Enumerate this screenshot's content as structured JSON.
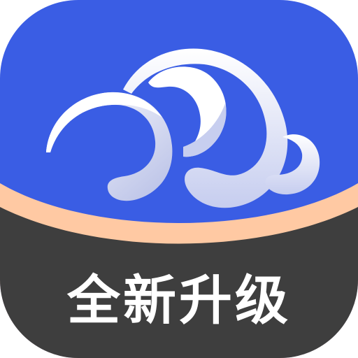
{
  "app_icon": {
    "icon": "cloud-icon",
    "banner_text": "全新升级",
    "colors": {
      "background_blue": "#3A5DE4",
      "accent_peach": "#FFC9A3",
      "banner_dark": "#3E3E3E",
      "banner_text": "#FFFFFF",
      "cloud_white": "#FFFFFF",
      "cloud_shade": "#B9C1E8"
    }
  }
}
